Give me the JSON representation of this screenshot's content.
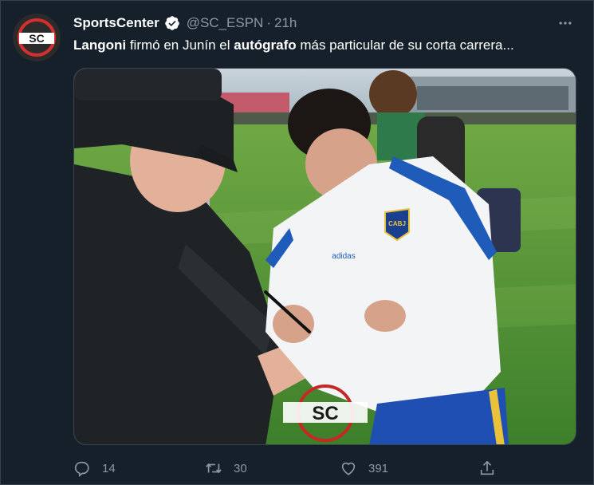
{
  "account": {
    "display_name": "SportsCenter",
    "handle": "@SC_ESPN",
    "separator": "·",
    "time_ago": "21h",
    "avatar_text": "SC",
    "verified": true
  },
  "tweet": {
    "text_parts": {
      "p1": "Langoni",
      "p2": " firmó en Junín el ",
      "p3": "autógrafo",
      "p4": " más particular de su corta carrera..."
    }
  },
  "media": {
    "watermark": "SC",
    "crest_text": "CABJ",
    "brand_text": "adidas"
  },
  "actions": {
    "reply_count": "14",
    "retweet_count": "30",
    "like_count": "391"
  },
  "colors": {
    "background": "#15202b",
    "secondary_text": "#8b98a5",
    "verified_blue": "#1d9bf0",
    "border": "#38444d"
  },
  "icons": {
    "more": "more-icon",
    "reply": "reply-icon",
    "retweet": "retweet-icon",
    "like": "heart-icon",
    "share": "share-icon"
  }
}
